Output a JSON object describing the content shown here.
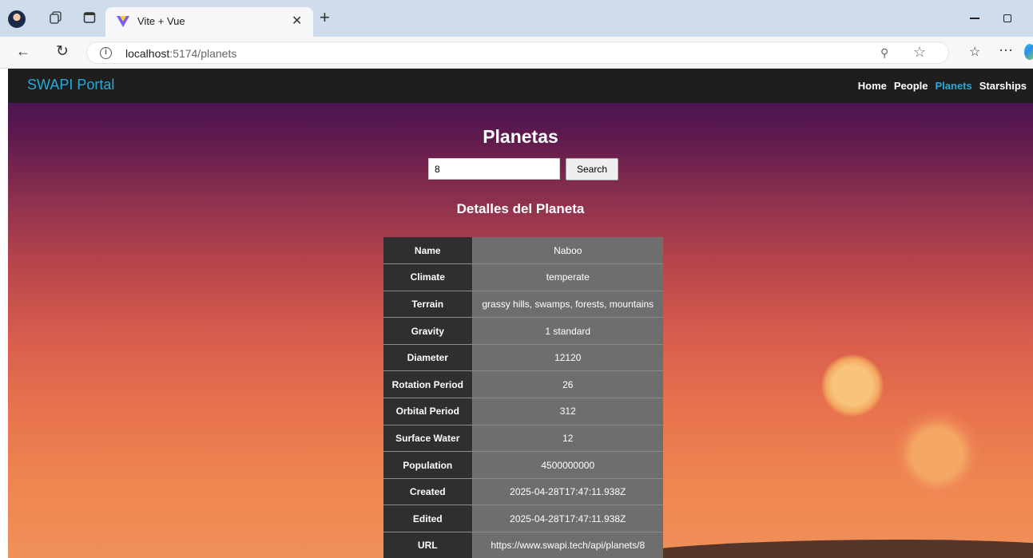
{
  "browser": {
    "tab_title": "Vite + Vue",
    "url_host": "localhost",
    "url_rest": ":5174/planets"
  },
  "app": {
    "brand": "SWAPI Portal",
    "nav": [
      "Home",
      "People",
      "Planets",
      "Starships"
    ],
    "active_nav": "Planets"
  },
  "page": {
    "title": "Planetas",
    "search_value": "8",
    "search_button": "Search",
    "details_title": "Detalles del Planeta"
  },
  "planet": {
    "rows": [
      {
        "label": "Name",
        "value": "Naboo"
      },
      {
        "label": "Climate",
        "value": "temperate"
      },
      {
        "label": "Terrain",
        "value": "grassy hills, swamps, forests, mountains"
      },
      {
        "label": "Gravity",
        "value": "1 standard"
      },
      {
        "label": "Diameter",
        "value": "12120"
      },
      {
        "label": "Rotation Period",
        "value": "26"
      },
      {
        "label": "Orbital Period",
        "value": "312"
      },
      {
        "label": "Surface Water",
        "value": "12"
      },
      {
        "label": "Population",
        "value": "4500000000"
      },
      {
        "label": "Created",
        "value": "2025-04-28T17:47:11.938Z"
      },
      {
        "label": "Edited",
        "value": "2025-04-28T17:47:11.938Z"
      },
      {
        "label": "URL",
        "value": "https://www.swapi.tech/api/planets/8"
      }
    ]
  },
  "colors": {
    "accent": "#27a9d8",
    "navbar": "#1e1e1e",
    "label_cell": "#2f2f2f",
    "value_cell": "#6e6e6e"
  }
}
